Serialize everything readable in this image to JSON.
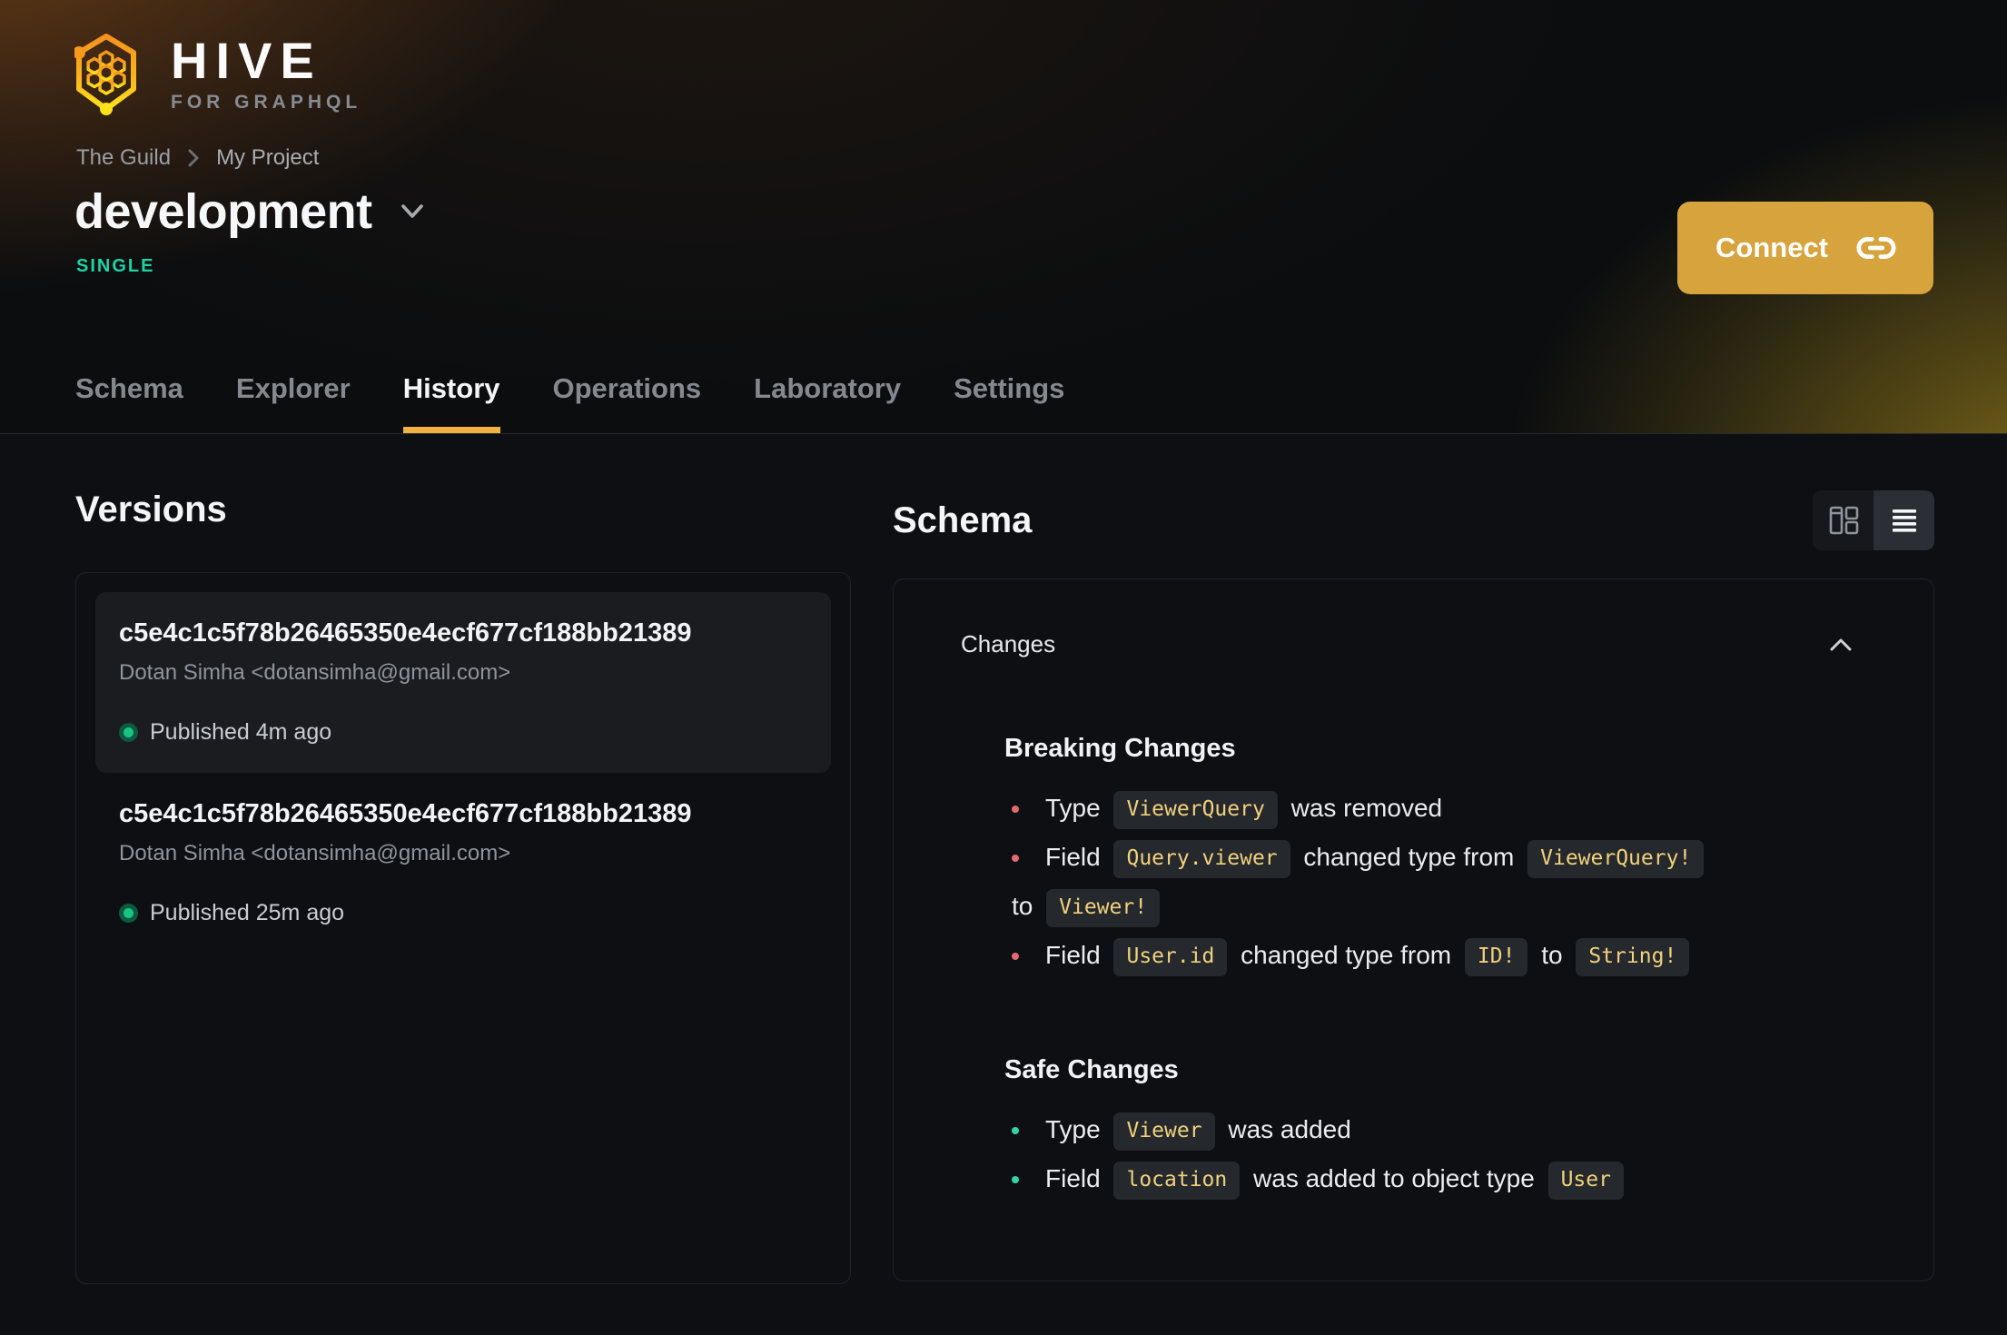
{
  "brand": {
    "name": "HIVE",
    "tagline": "FOR GRAPHQL"
  },
  "breadcrumb": {
    "org": "The Guild",
    "project": "My Project"
  },
  "target": {
    "name": "development",
    "badge": "SINGLE"
  },
  "connect": {
    "label": "Connect"
  },
  "tabs": [
    {
      "label": "Schema",
      "active": false
    },
    {
      "label": "Explorer",
      "active": false
    },
    {
      "label": "History",
      "active": true
    },
    {
      "label": "Operations",
      "active": false
    },
    {
      "label": "Laboratory",
      "active": false
    },
    {
      "label": "Settings",
      "active": false
    }
  ],
  "versions": {
    "heading": "Versions",
    "items": [
      {
        "hash": "c5e4c1c5f78b26465350e4ecf677cf188bb21389",
        "author": "Dotan Simha <dotansimha@gmail.com>",
        "status": "Published 4m ago",
        "active": true
      },
      {
        "hash": "c5e4c1c5f78b26465350e4ecf677cf188bb21389",
        "author": "Dotan Simha <dotansimha@gmail.com>",
        "status": "Published 25m ago",
        "active": false
      }
    ]
  },
  "schema_panel": {
    "heading": "Schema",
    "changes_title": "Changes",
    "sections": [
      {
        "heading": "Breaking Changes",
        "type": "breaking",
        "items": [
          [
            {
              "text": "Type "
            },
            {
              "chip": "ViewerQuery"
            },
            {
              "text": " was removed"
            }
          ],
          [
            {
              "text": "Field "
            },
            {
              "chip": "Query.viewer"
            },
            {
              "text": " changed type from "
            },
            {
              "chip": "ViewerQuery!"
            },
            {
              "break": true
            },
            {
              "text": "to "
            },
            {
              "chip": "Viewer!"
            }
          ],
          [
            {
              "text": "Field "
            },
            {
              "chip": "User.id"
            },
            {
              "text": " changed type from "
            },
            {
              "chip": "ID!"
            },
            {
              "text": " to "
            },
            {
              "chip": "String!"
            }
          ]
        ]
      },
      {
        "heading": "Safe Changes",
        "type": "safe",
        "items": [
          [
            {
              "text": "Type "
            },
            {
              "chip": "Viewer"
            },
            {
              "text": " was added"
            }
          ],
          [
            {
              "text": "Field "
            },
            {
              "chip": "location"
            },
            {
              "text": " was added to object type "
            },
            {
              "chip": "User"
            }
          ]
        ]
      }
    ]
  },
  "colors": {
    "accent_underline": "#f0b341",
    "connect_button": "#d7a33c",
    "badge_single": "#1ed3a4",
    "breaking_bullet": "#e16a6f",
    "safe_bullet": "#2fd6a3",
    "chip_text": "#f0d17d",
    "published_dot": "#17c57f"
  }
}
